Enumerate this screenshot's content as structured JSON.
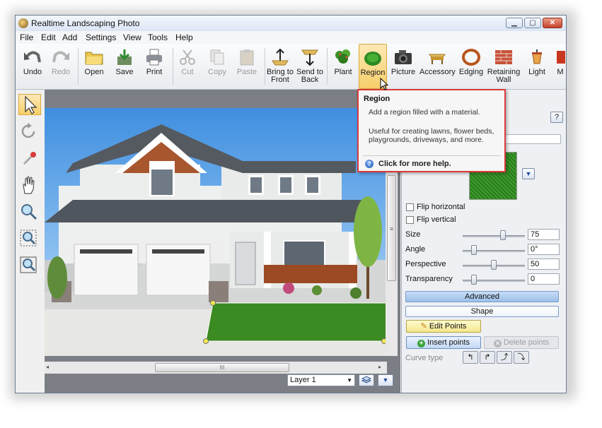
{
  "window": {
    "title": "Realtime Landscaping Photo"
  },
  "menu": [
    "File",
    "Edit",
    "Add",
    "Settings",
    "View",
    "Tools",
    "Help"
  ],
  "toolbar": [
    {
      "label": "Undo",
      "icon": "undo-icon",
      "enabled": true
    },
    {
      "label": "Redo",
      "icon": "redo-icon",
      "enabled": false
    },
    {
      "label": "Open",
      "icon": "folder-icon",
      "enabled": true
    },
    {
      "label": "Save",
      "icon": "save-icon",
      "enabled": true
    },
    {
      "label": "Print",
      "icon": "printer-icon",
      "enabled": true
    },
    {
      "label": "Cut",
      "icon": "scissors-icon",
      "enabled": false
    },
    {
      "label": "Copy",
      "icon": "copy-icon",
      "enabled": false
    },
    {
      "label": "Paste",
      "icon": "paste-icon",
      "enabled": false
    },
    {
      "label": "Bring to Front",
      "icon": "bring-front-icon",
      "enabled": true
    },
    {
      "label": "Send to Back",
      "icon": "send-back-icon",
      "enabled": true
    },
    {
      "label": "Plant",
      "icon": "plant-icon",
      "enabled": true
    },
    {
      "label": "Region",
      "icon": "region-icon",
      "enabled": true,
      "active": true
    },
    {
      "label": "Picture",
      "icon": "camera-icon",
      "enabled": true
    },
    {
      "label": "Accessory",
      "icon": "bench-icon",
      "enabled": true
    },
    {
      "label": "Edging",
      "icon": "edging-icon",
      "enabled": true
    },
    {
      "label": "Retaining Wall",
      "icon": "brick-wall-icon",
      "enabled": true
    },
    {
      "label": "Light",
      "icon": "lantern-icon",
      "enabled": true
    },
    {
      "label": "M",
      "icon": "more-icon",
      "enabled": true
    }
  ],
  "tooltip": {
    "title": "Region",
    "description": "Add a region filled with a material.",
    "detail": "Useful for creating lawns, flower beds, playgrounds, driveways, and more.",
    "help": "Click for more help."
  },
  "canvas": {
    "scroll_thumb_label": "III",
    "vscroll_thumb_label": "≡",
    "layer": "Layer 1"
  },
  "properties": {
    "help_button": "?",
    "flip_horizontal": "Flip horizontal",
    "flip_vertical": "Flip vertical",
    "sliders": [
      {
        "label": "Size",
        "value": "75",
        "level": 0.65
      },
      {
        "label": "Angle",
        "value": "0°",
        "level": 0.18
      },
      {
        "label": "Perspective",
        "value": "50",
        "level": 0.5
      },
      {
        "label": "Transparency",
        "value": "0",
        "level": 0.18
      }
    ],
    "advanced": "Advanced",
    "shape": "Shape",
    "edit_points": "Edit Points",
    "insert_points": "Insert points",
    "delete_points": "Delete points",
    "curve_type": "Curve type"
  },
  "colors": {
    "accent": "#d93a3a",
    "active_tool": "#f7cf6a",
    "lawn": "#3c8a22"
  }
}
